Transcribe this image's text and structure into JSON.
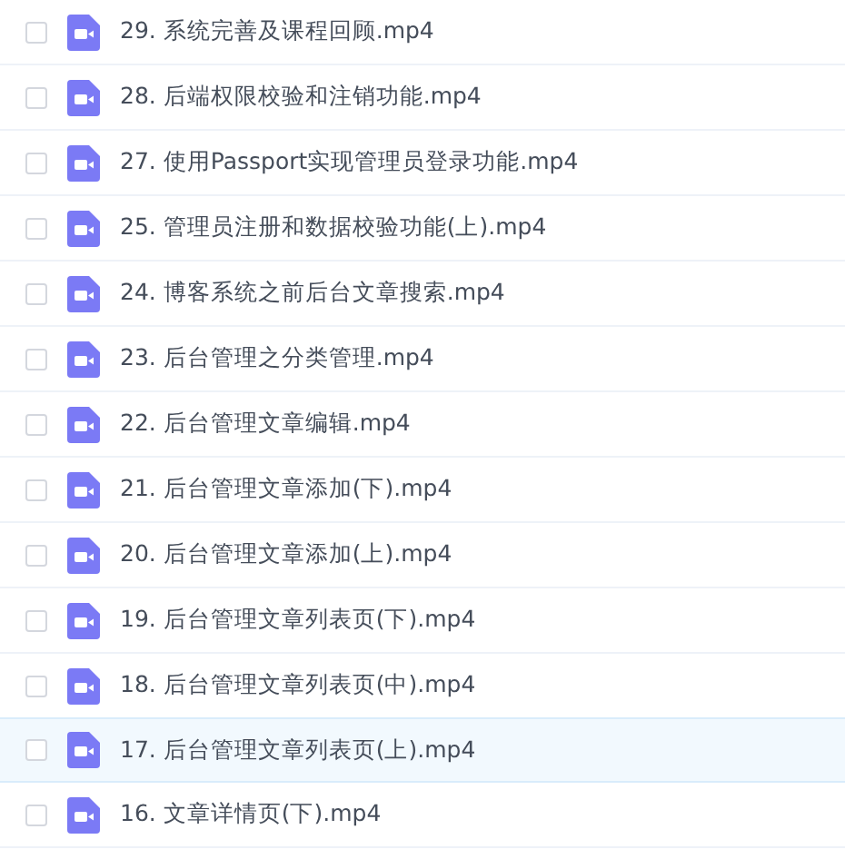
{
  "files": [
    {
      "name": "29. 系统完善及课程回顾.mp4",
      "checked": false,
      "selected": false
    },
    {
      "name": "28. 后端权限校验和注销功能.mp4",
      "checked": false,
      "selected": false
    },
    {
      "name": "27. 使用Passport实现管理员登录功能.mp4",
      "checked": false,
      "selected": false
    },
    {
      "name": "25. 管理员注册和数据校验功能(上).mp4",
      "checked": false,
      "selected": false
    },
    {
      "name": "24. 博客系统之前后台文章搜索.mp4",
      "checked": false,
      "selected": false
    },
    {
      "name": "23. 后台管理之分类管理.mp4",
      "checked": false,
      "selected": false
    },
    {
      "name": "22. 后台管理文章编辑.mp4",
      "checked": false,
      "selected": false
    },
    {
      "name": "21. 后台管理文章添加(下).mp4",
      "checked": false,
      "selected": false
    },
    {
      "name": "20. 后台管理文章添加(上).mp4",
      "checked": false,
      "selected": false
    },
    {
      "name": "19. 后台管理文章列表页(下).mp4",
      "checked": false,
      "selected": false
    },
    {
      "name": "18. 后台管理文章列表页(中).mp4",
      "checked": false,
      "selected": false
    },
    {
      "name": "17. 后台管理文章列表页(上).mp4",
      "checked": false,
      "selected": true
    },
    {
      "name": "16. 文章详情页(下).mp4",
      "checked": false,
      "selected": false
    }
  ]
}
